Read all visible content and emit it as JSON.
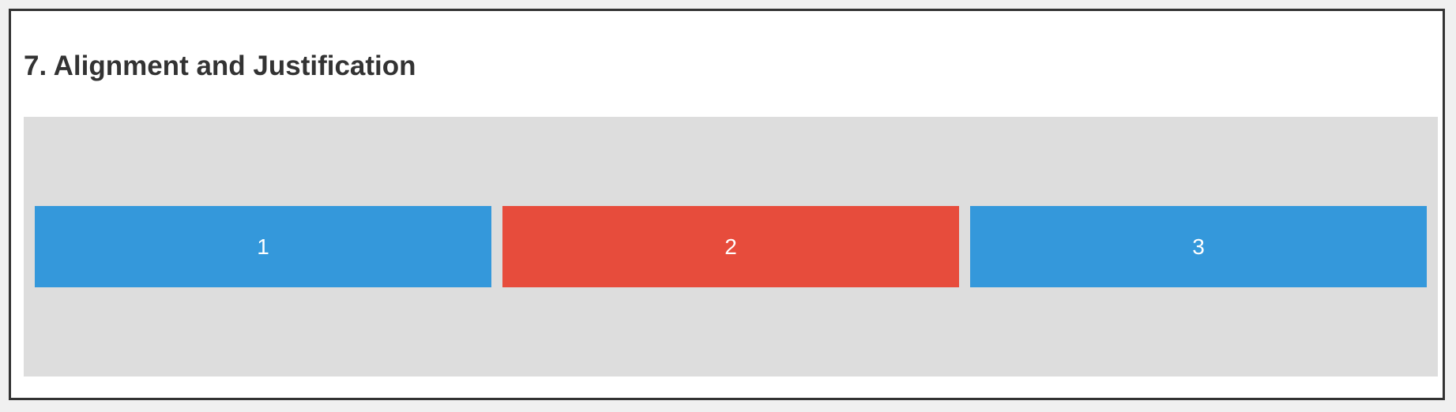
{
  "section": {
    "title": "7. Alignment and Justification"
  },
  "items": [
    {
      "label": "1",
      "color": "#3498db"
    },
    {
      "label": "2",
      "color": "#e74c3c"
    },
    {
      "label": "3",
      "color": "#3498db"
    }
  ],
  "colors": {
    "page_background": "#f0f0f0",
    "panel_background": "#ffffff",
    "panel_border": "#333333",
    "container_background": "#dddddd",
    "title_text": "#333333",
    "item_text": "#ffffff"
  }
}
